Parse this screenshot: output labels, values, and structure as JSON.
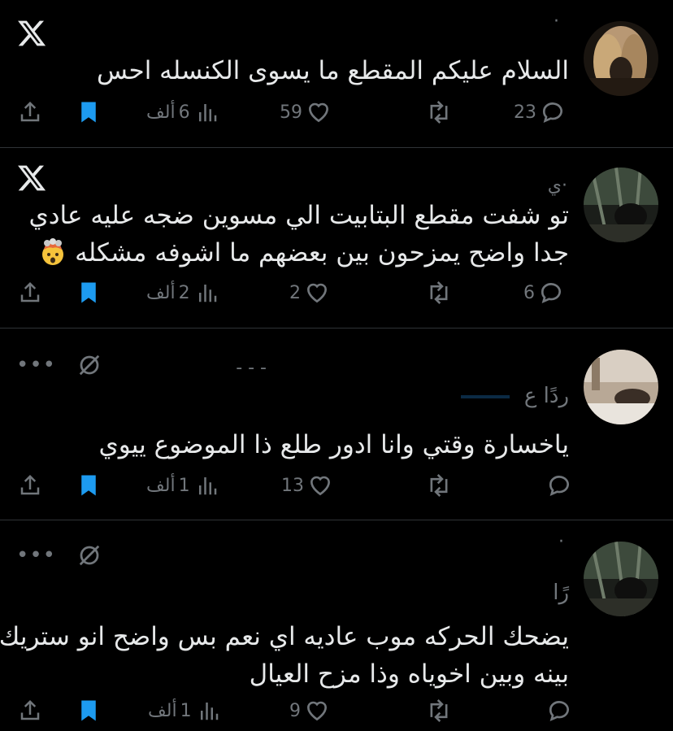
{
  "colors": {
    "background": "#000000",
    "text": "#e7e9ea",
    "muted": "#71767b",
    "bookmark_active": "#1d9bf0",
    "divider": "#2f3336"
  },
  "tweets": [
    {
      "author_blurred": "·",
      "text_lines": [
        "السلام عليكم المقطع ما يسوى الكنسله احس"
      ],
      "emoji": "",
      "reply_count": "23",
      "like_count": "59",
      "views_value": "6",
      "views_unit": "ألف",
      "bookmarked": true,
      "top_icon": "x-logo-icon"
    },
    {
      "author_blurred": "ي·",
      "text_lines": [
        "تو شفت مقطع البتابيت الي مسوين ضجه عليه عادي",
        "جدا واضح يمزحون بين بعضهم ما اشوفه مشكله"
      ],
      "emoji": "exploding-head-icon",
      "reply_count": "6",
      "like_count": "2",
      "views_value": "2",
      "views_unit": "ألف",
      "bookmarked": true,
      "top_icon": "x-logo-icon"
    },
    {
      "author_blurred": "- - -",
      "reply_prefix": "ردًا ع",
      "text_lines": [
        "ياخسارة وقتي وانا ادور طلع ذا الموضوع ييوي"
      ],
      "emoji": "",
      "reply_count": "",
      "like_count": "13",
      "views_value": "1",
      "views_unit": "ألف",
      "bookmarked": true,
      "top_icon": "grok-icon"
    },
    {
      "author_blurred": "·",
      "reply_prefix": "رًا",
      "text_lines": [
        "يضحك الحركه موب عاديه اي نعم بس واضح انو ستريك",
        "بينه وبين اخوياه وذا مزح العيال"
      ],
      "emoji": "",
      "reply_count": "",
      "like_count": "9",
      "views_value": "1",
      "views_unit": "ألف",
      "bookmarked": true,
      "top_icon": "grok-icon"
    }
  ]
}
